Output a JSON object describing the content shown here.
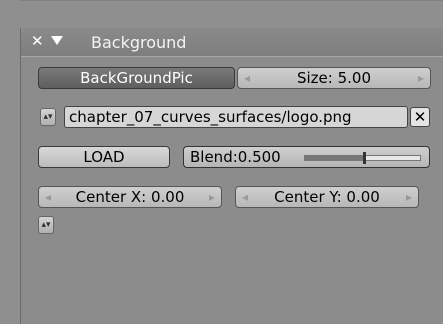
{
  "panel": {
    "title": "Background",
    "background_pic_label": "BackGroundPic",
    "size_label": "Size: 5.00",
    "image_path": "chapter_07_curves_surfaces/logo.png",
    "load_label": "LOAD",
    "blend_label": "Blend:0.500",
    "blend_value": 0.5,
    "center_x_label": "Center X: 0.00",
    "center_y_label": "Center Y: 0.00",
    "close_glyph": "✕",
    "remove_glyph": "✕"
  },
  "icons": [
    "close-icon",
    "collapse-triangle-icon",
    "left-arrow-icon",
    "right-arrow-icon",
    "updown-arrows-icon",
    "remove-x-icon"
  ],
  "colors": {
    "panel_bg": "#8c8c8c",
    "header_bg": "#828282",
    "dark_button": "#6a6a6a",
    "light_field": "#d6d6d6"
  }
}
